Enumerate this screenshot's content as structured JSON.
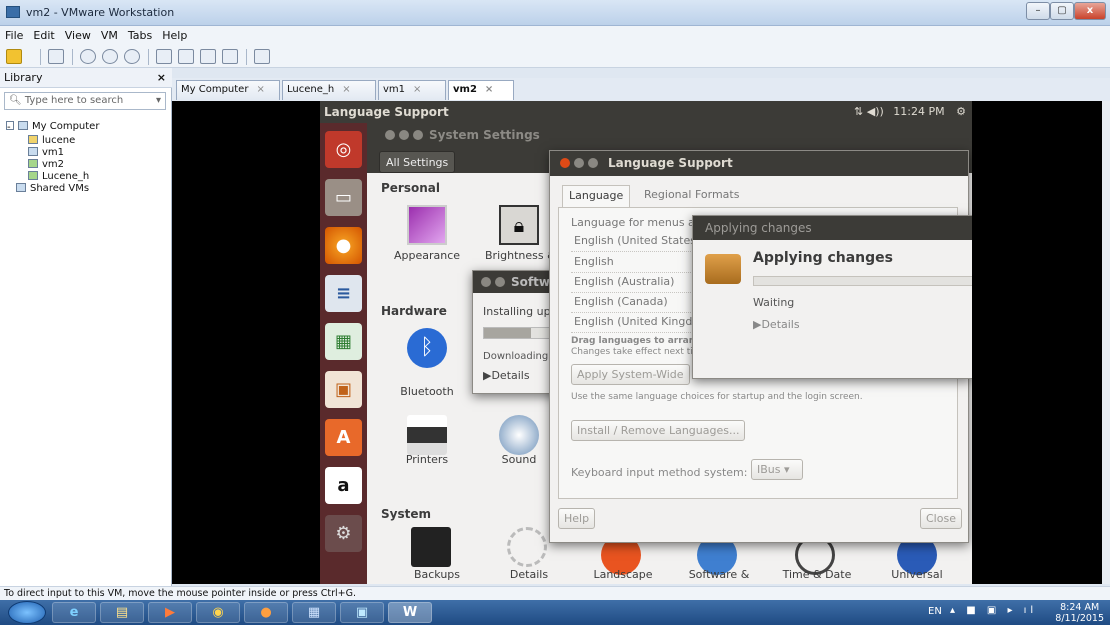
{
  "window": {
    "title": "vm2 - VMware Workstation",
    "min_label": "–",
    "max_label": "▢",
    "close_label": "x"
  },
  "menu": [
    "File",
    "Edit",
    "View",
    "VM",
    "Tabs",
    "Help"
  ],
  "library": {
    "title": "Library",
    "close": "×",
    "search_placeholder": "Type here to search",
    "tree": [
      "My Computer",
      "lucene",
      "vm1",
      "vm2",
      "Lucene_h",
      "Shared VMs"
    ]
  },
  "tabs": [
    {
      "label": "My Computer",
      "close": "×"
    },
    {
      "label": "Lucene_h",
      "close": "×"
    },
    {
      "label": "vm1",
      "close": "×"
    },
    {
      "label": "vm2",
      "close": "×"
    }
  ],
  "ubuntu": {
    "topbar_title": "Language Support",
    "tray_time": "11:24 PM",
    "tray_icons": "⇅ ◀))",
    "gear": "⚙"
  },
  "settings": {
    "title": "System Settings",
    "all_settings": "All Settings",
    "personal": "Personal",
    "appearance": "Appearance",
    "brightness": "Brightness & Lock",
    "hardware": "Hardware",
    "bluetooth": "Bluetooth",
    "printers": "Printers",
    "sound": "Sound",
    "system": "System",
    "bottom_labels": [
      "Backups",
      "Details",
      "Landscape",
      "Software &",
      "Time & Date",
      "Universal"
    ]
  },
  "software_dialog": {
    "title": "Softw",
    "installing": "Installing upd",
    "downloading": "Downloading",
    "details": "▶Details"
  },
  "language_support": {
    "title": "Language Support",
    "tab_language": "Language",
    "tab_regional": "Regional Formats",
    "menus_label": "Language for menus a",
    "languages": [
      "English (United States",
      "English",
      "English (Australia)",
      "English (Canada)",
      "English (United Kingdo"
    ],
    "drag_hint": "Drag languages to arrange",
    "changes_hint": "Changes take effect next ti",
    "apply_button": "Apply System-Wide",
    "startup_hint": "Use the same language choices for startup and the login screen.",
    "install_button": "Install / Remove Languages...",
    "keyboard_label": "Keyboard input method system:",
    "keyboard_value": "IBus",
    "help": "Help",
    "close": "Close"
  },
  "applying": {
    "title": "Applying changes",
    "heading": "Applying changes",
    "status": "Waiting",
    "details": "▶Details"
  },
  "statusbar": "To direct input to this VM, move the mouse pointer inside or press Ctrl+G.",
  "taskbar": {
    "lang": "EN",
    "time": "8:24 AM",
    "date": "8/11/2015",
    "word": "W"
  }
}
